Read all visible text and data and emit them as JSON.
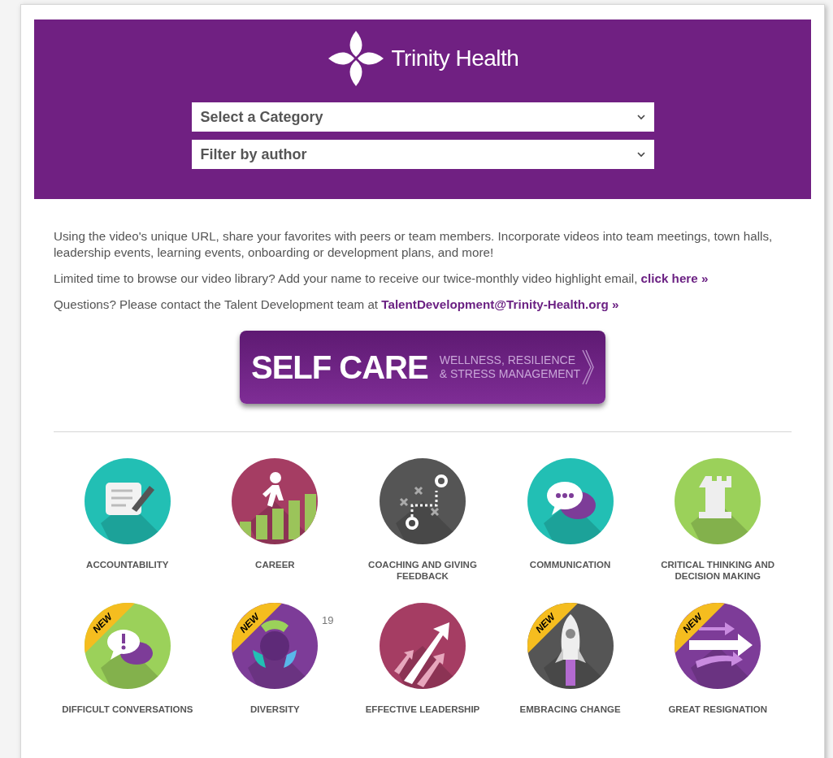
{
  "header": {
    "logo_text": "Trinity Health",
    "dropdowns": [
      {
        "value": "Select a Category"
      },
      {
        "value": "Filter by author"
      }
    ]
  },
  "intro": [
    {
      "text": "Using the video's unique URL, share your favorites with peers or team members. Incorporate videos into team meetings, town halls, leadership events, learning events, onboarding or development plans, and more!"
    },
    {
      "text": "Limited time to browse our video library? Add your name to receive our twice-monthly video highlight email,",
      "link": "click here »"
    },
    {
      "text": "Questions? Please contact the Talent Development team at",
      "link": "TalentDevelopment@Trinity-Health.org »"
    }
  ],
  "feature_banner": {
    "title": "SELF CARE",
    "subtitle_lines": [
      "WELLNESS, RESILIENCE",
      "& STRESS MANAGEMENT"
    ]
  },
  "categories": [
    {
      "label": "ACCOUNTABILITY",
      "color": "#22bfb4"
    },
    {
      "label": "CAREER",
      "color": "#a53d63"
    },
    {
      "label": "COACHING AND GIVING FEEDBACK",
      "color": "#555555"
    },
    {
      "label": "COMMUNICATION",
      "color": "#22bfb4"
    },
    {
      "label": "CRITICAL THINKING AND DECISION MAKING",
      "color": "#9bd15a"
    },
    {
      "label": "DIFFICULT CONVERSATIONS",
      "color": "#9bd15a",
      "badge": "NEW"
    },
    {
      "label": "DIVERSITY",
      "color": "#7d3c98",
      "badge": "NEW"
    },
    {
      "label": "EFFECTIVE LEADERSHIP",
      "color": "#a53d63"
    },
    {
      "label": "EMBRACING CHANGE",
      "color": "#555555",
      "badge": "NEW"
    },
    {
      "label": "GREAT RESIGNATION",
      "color": "#7d3c98",
      "badge": "NEW"
    }
  ],
  "page_number": "19"
}
